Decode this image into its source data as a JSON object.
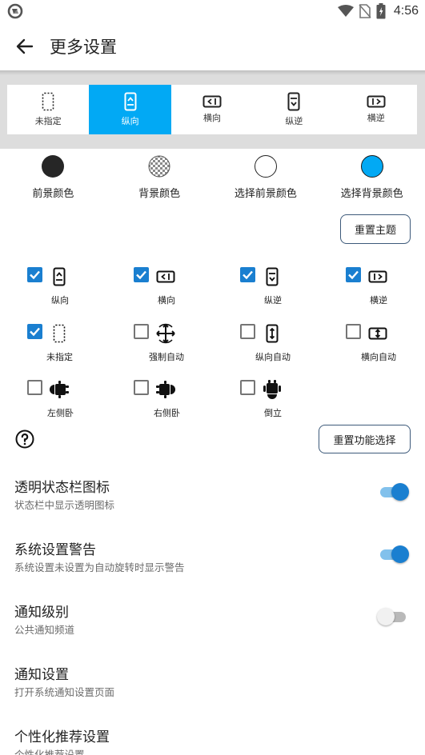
{
  "status_bar": {
    "time": "4:56"
  },
  "app_bar": {
    "title": "更多设置"
  },
  "orientation_tabs": [
    {
      "label": "未指定",
      "icon": "phone-dotted-icon",
      "selected": false
    },
    {
      "label": "纵向",
      "icon": "portrait-phone-icon",
      "selected": true
    },
    {
      "label": "横向",
      "icon": "landscape-phone-icon",
      "selected": false
    },
    {
      "label": "纵逆",
      "icon": "reverse-portrait-icon",
      "selected": false
    },
    {
      "label": "横逆",
      "icon": "reverse-landscape-icon",
      "selected": false
    }
  ],
  "colors": [
    {
      "label": "前景颜色",
      "color": "#262626"
    },
    {
      "label": "背景颜色",
      "color": "checkered"
    },
    {
      "label": "选择前景颜色",
      "color": "#ffffff"
    },
    {
      "label": "选择背景颜色",
      "color": "#02a9f4"
    }
  ],
  "buttons": {
    "reset_theme": "重置主题",
    "reset_functions": "重置功能选择"
  },
  "functions": [
    {
      "label": "纵向",
      "checked": true
    },
    {
      "label": "横向",
      "checked": true
    },
    {
      "label": "纵逆",
      "checked": true
    },
    {
      "label": "横逆",
      "checked": true
    },
    {
      "label": "未指定",
      "checked": true
    },
    {
      "label": "强制自动",
      "checked": false
    },
    {
      "label": "纵向自动",
      "checked": false
    },
    {
      "label": "横向自动",
      "checked": false
    },
    {
      "label": "左侧卧",
      "checked": false
    },
    {
      "label": "右侧卧",
      "checked": false
    },
    {
      "label": "倒立",
      "checked": false
    }
  ],
  "settings": [
    {
      "title": "透明状态栏图标",
      "subtitle": "状态栏中显示透明图标",
      "toggle": true
    },
    {
      "title": "系统设置警告",
      "subtitle": "系统设置未设置为自动旋转时显示警告",
      "toggle": true
    },
    {
      "title": "通知级别",
      "subtitle": "公共通知频道",
      "toggle": false
    },
    {
      "title": "通知设置",
      "subtitle": "打开系统通知设置页面"
    },
    {
      "title": "个性化推荐设置",
      "subtitle": "个性化推荐设置"
    }
  ],
  "accent_color": "#02a9f4",
  "checkbox_color": "#1a7fd0"
}
